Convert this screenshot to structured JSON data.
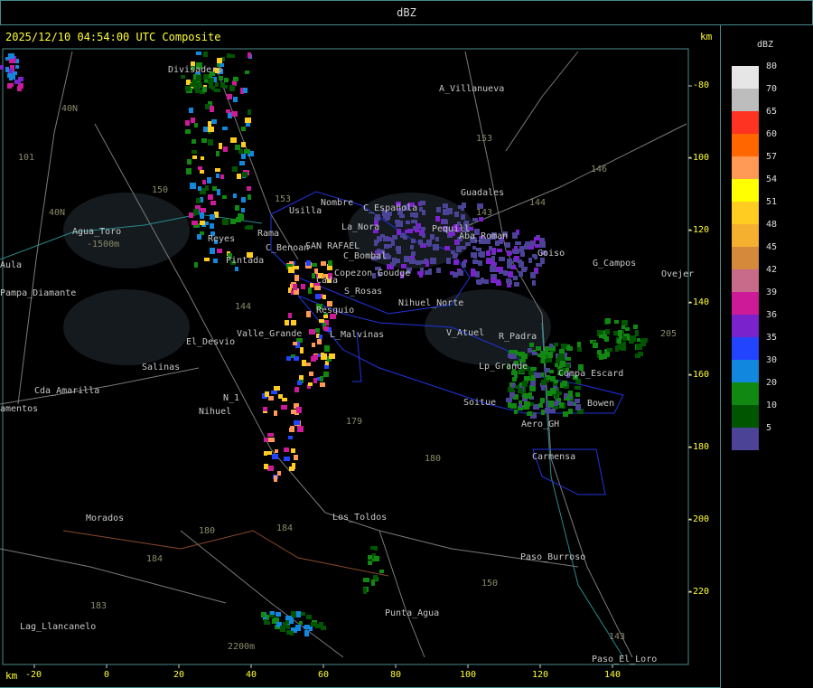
{
  "header": {
    "title": "dBZ"
  },
  "map": {
    "timestamp": "2025/12/10 04:54:00 UTC Composite",
    "km_label": "km",
    "x_axis": {
      "unit": "km",
      "ticks": [
        "-20",
        "0",
        "20",
        "40",
        "60",
        "80",
        "100",
        "120",
        "140"
      ]
    },
    "y_axis": {
      "unit": "km",
      "ticks": [
        "-80",
        "-100",
        "-120",
        "-140",
        "-160",
        "-180",
        "-200",
        "-220"
      ]
    },
    "places": [
      "Divisadero",
      "A_Villanueva",
      "Guadales",
      "Usilla",
      "Nombre",
      "La_Nora",
      "C_Española",
      "Pequill",
      "Aba_Roman",
      "Goiso",
      "G_Campos",
      "Ovejer",
      "Agua_Toro",
      "-1500m",
      "Aula",
      "Pampa_Diamante",
      "C_Benoan",
      "SAN RAFAEL",
      "C_Bombal",
      "Pintada",
      "Copezon Goudge",
      "Reyes",
      "Rama",
      "Cada",
      "S_Rosas",
      "Nihuel_Norte",
      "Resquio",
      "El_Desvio",
      "Valle_Grande",
      "L_Malvinas",
      "V_Atuel",
      "R_Padra",
      "Salinas",
      "Nihuel",
      "N_1",
      "Cda_Amarilla",
      "amentos",
      "Soitue",
      "Aero_GH",
      "Bowen",
      "Carmensa",
      "Morados",
      "Los_Toldos",
      "Paso_Burroso",
      "Punta_Agua",
      "Lag_Llancanelo",
      "2200m",
      "Paso_El_Loro",
      "Compa_Escard",
      "Lp_Grande"
    ],
    "routes": [
      "101",
      "40N",
      "40N",
      "153",
      "146",
      "143",
      "144",
      "150",
      "153",
      "144",
      "180",
      "179",
      "184",
      "180",
      "184",
      "183",
      "150",
      "143",
      "205"
    ]
  },
  "legend": {
    "title": "dBZ",
    "entries": [
      {
        "value": "80",
        "color": "#e6e6e6"
      },
      {
        "value": "70",
        "color": "#bdbdbd"
      },
      {
        "value": "65",
        "color": "#ff3322"
      },
      {
        "value": "60",
        "color": "#ff6600"
      },
      {
        "value": "57",
        "color": "#ff9955"
      },
      {
        "value": "54",
        "color": "#ffff00"
      },
      {
        "value": "51",
        "color": "#ffcc22"
      },
      {
        "value": "48",
        "color": "#f5b030"
      },
      {
        "value": "45",
        "color": "#d48a3a"
      },
      {
        "value": "42",
        "color": "#c86a8a"
      },
      {
        "value": "39",
        "color": "#cc1a99"
      },
      {
        "value": "36",
        "color": "#7a22cc"
      },
      {
        "value": "35",
        "color": "#2244ff"
      },
      {
        "value": "30",
        "color": "#1188dd"
      },
      {
        "value": "20",
        "color": "#118811"
      },
      {
        "value": "10",
        "color": "#005500"
      },
      {
        "value": "5",
        "color": "#4b4496"
      }
    ]
  }
}
